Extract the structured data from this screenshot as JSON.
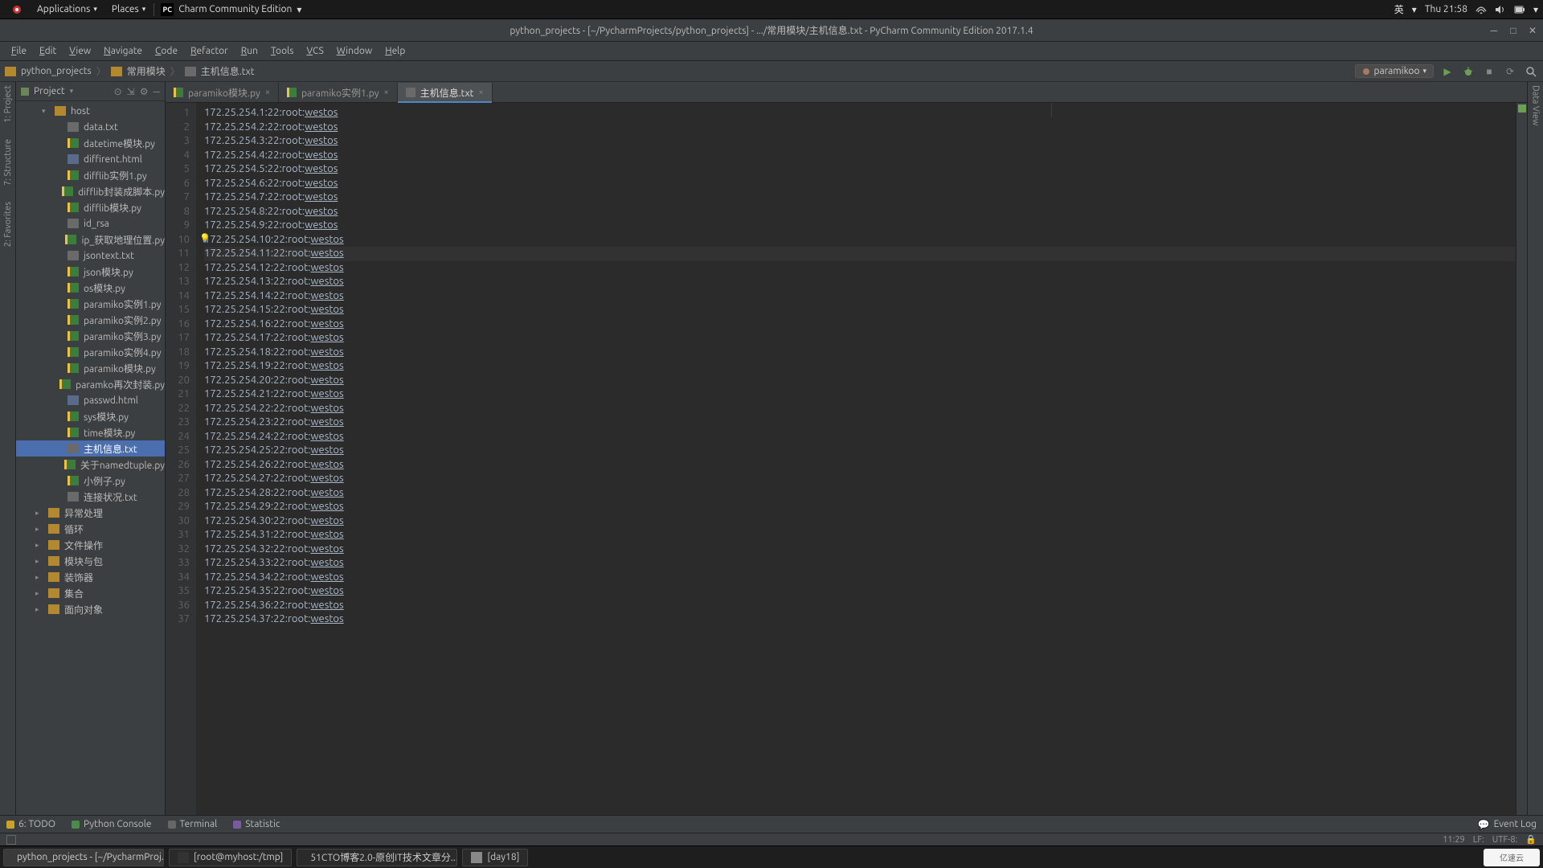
{
  "gnome": {
    "apps": "Applications",
    "places": "Places",
    "app_switch": "Charm Community Edition",
    "lang": "英",
    "clock": "Thu 21:58"
  },
  "window": {
    "title": "python_projects - [~/PycharmProjects/python_projects] - .../常用模块/主机信息.txt - PyCharm Community Edition 2017.1.4"
  },
  "menus": [
    "File",
    "Edit",
    "View",
    "Navigate",
    "Code",
    "Refactor",
    "Run",
    "Tools",
    "VCS",
    "Window",
    "Help"
  ],
  "crumbs": [
    "python_projects",
    "常用模块",
    "主机信息.txt"
  ],
  "run_config": "paramikoo",
  "left_strip": [
    "1: Project",
    "7: Structure",
    "2: Favorites"
  ],
  "right_strip": [
    "Data View"
  ],
  "project_header": "Project",
  "tree": [
    {
      "ind": 32,
      "chev": "▾",
      "icon": "folder",
      "label": "host"
    },
    {
      "ind": 48,
      "icon": "txt",
      "label": "data.txt"
    },
    {
      "ind": 48,
      "icon": "py",
      "label": "datetime模块.py"
    },
    {
      "ind": 48,
      "icon": "html",
      "label": "diffirent.html"
    },
    {
      "ind": 48,
      "icon": "py",
      "label": "difflib实例1.py"
    },
    {
      "ind": 48,
      "icon": "py",
      "label": "difflib封装成脚本.py"
    },
    {
      "ind": 48,
      "icon": "py",
      "label": "difflib模块.py"
    },
    {
      "ind": 48,
      "icon": "txt",
      "label": "id_rsa"
    },
    {
      "ind": 48,
      "icon": "py",
      "label": "ip_获取地理位置.py"
    },
    {
      "ind": 48,
      "icon": "txt",
      "label": "jsontext.txt"
    },
    {
      "ind": 48,
      "icon": "py",
      "label": "json模块.py"
    },
    {
      "ind": 48,
      "icon": "py",
      "label": "os模块.py"
    },
    {
      "ind": 48,
      "icon": "py",
      "label": "paramiko实例1.py"
    },
    {
      "ind": 48,
      "icon": "py",
      "label": "paramiko实例2.py"
    },
    {
      "ind": 48,
      "icon": "py",
      "label": "paramiko实例3.py"
    },
    {
      "ind": 48,
      "icon": "py",
      "label": "paramiko实例4.py"
    },
    {
      "ind": 48,
      "icon": "py",
      "label": "paramiko模块.py"
    },
    {
      "ind": 48,
      "icon": "py",
      "label": "paramko再次封装.py"
    },
    {
      "ind": 48,
      "icon": "html",
      "label": "passwd.html"
    },
    {
      "ind": 48,
      "icon": "py",
      "label": "sys模块.py"
    },
    {
      "ind": 48,
      "icon": "py",
      "label": "time模块.py"
    },
    {
      "ind": 48,
      "icon": "txt",
      "label": "主机信息.txt",
      "selected": true
    },
    {
      "ind": 48,
      "icon": "py",
      "label": "关于namedtuple.py"
    },
    {
      "ind": 48,
      "icon": "py",
      "label": "小例子.py"
    },
    {
      "ind": 48,
      "icon": "txt",
      "label": "连接状况.txt"
    },
    {
      "ind": 24,
      "chev": "▸",
      "icon": "folder",
      "label": "异常处理"
    },
    {
      "ind": 24,
      "chev": "▸",
      "icon": "folder",
      "label": "循环"
    },
    {
      "ind": 24,
      "chev": "▸",
      "icon": "folder",
      "label": "文件操作"
    },
    {
      "ind": 24,
      "chev": "▸",
      "icon": "folder",
      "label": "模块与包"
    },
    {
      "ind": 24,
      "chev": "▸",
      "icon": "folder",
      "label": "装饰器"
    },
    {
      "ind": 24,
      "chev": "▸",
      "icon": "folder",
      "label": "集合"
    },
    {
      "ind": 24,
      "chev": "▸",
      "icon": "folder",
      "label": "面向对象"
    }
  ],
  "tabs": [
    {
      "label": "paramiko模块.py",
      "icon": "py"
    },
    {
      "label": "paramiko实例1.py",
      "icon": "py"
    },
    {
      "label": "主机信息.txt",
      "icon": "txt",
      "active": true
    }
  ],
  "editor_lines_prefix": "172.25.254.",
  "editor_lines_suffix_a": ":22:root:",
  "editor_lines_suffix_b": "westos",
  "line_count": 37,
  "current_line": 11,
  "bulb_line": 10,
  "bottom_tools": [
    {
      "dot": "y",
      "label": "6: TODO"
    },
    {
      "dot": "g",
      "label": "Python Console"
    },
    {
      "dot": "t",
      "label": "Terminal"
    },
    {
      "dot": "p",
      "label": "Statistic"
    }
  ],
  "event_log": "Event Log",
  "status": {
    "pos": "11:29",
    "sep": "LF:",
    "enc": "UTF-8:"
  },
  "taskbar": [
    {
      "icon": "pc",
      "label": "python_projects - [~/PycharmProj..."
    },
    {
      "icon": "term",
      "label": "[root@myhost:/tmp]"
    },
    {
      "icon": "ff",
      "label": "51CTO博客2.0-原创IT技术文章分..."
    },
    {
      "icon": "doc",
      "label": "[day18]"
    }
  ],
  "cloud_text": "亿速云"
}
